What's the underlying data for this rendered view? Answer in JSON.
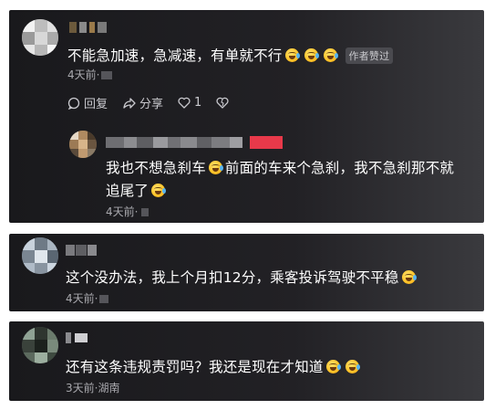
{
  "comments": [
    {
      "text": "不能急加速，急减速，有单就不行",
      "emoji_count": 3,
      "badge": "作者赞过",
      "meta": "4天前·",
      "actions": {
        "reply": "回复",
        "share": "分享",
        "likes": "1"
      }
    },
    {
      "reply_line1": "我也不想急刹车",
      "reply_line1b": "前面的车来个急刹，我不急刹那不就",
      "reply_line2": "追尾了",
      "meta": "4天前·"
    },
    {
      "text": "这个没办法，我上个月扣12分，乘客投诉驾驶不平稳",
      "meta": "4天前·"
    },
    {
      "text": "还有这条违规责罚吗？我还是现在才知道",
      "meta": "3天前·湖南"
    }
  ],
  "icons": {
    "reply": "comment-bubble-icon",
    "share": "share-arrow-icon",
    "like": "heart-icon",
    "dislike": "broken-heart-icon",
    "emoji": "laughing-tears-emoji"
  },
  "colors": {
    "card_bg": "#1c1c1f",
    "meta_text": "#a9a9ae",
    "badge_bg": "#4a4a4f",
    "username_redacted": "#e8394a"
  }
}
